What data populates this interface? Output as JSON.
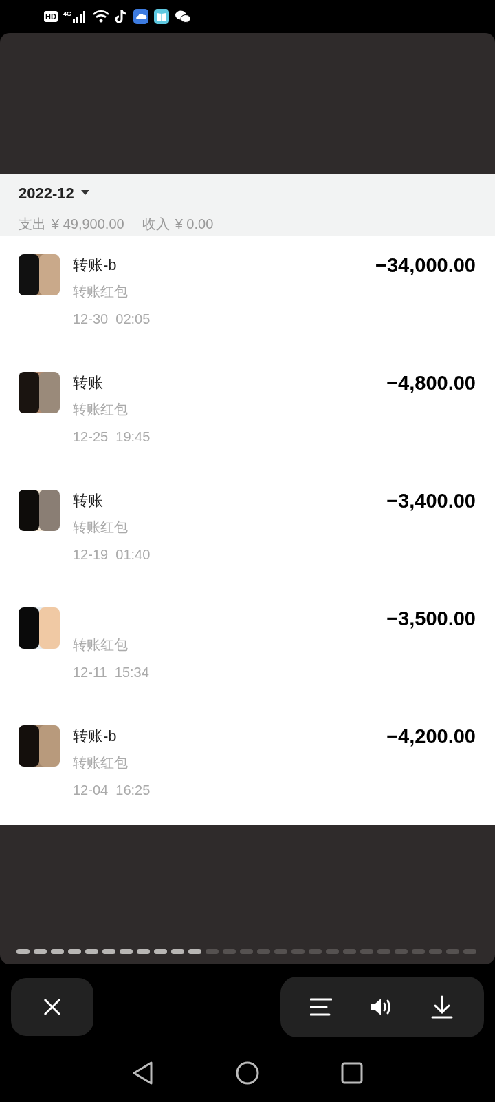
{
  "status_bar": {
    "hd": "HD",
    "network": "4G"
  },
  "month": {
    "label": "2022-12"
  },
  "summary": {
    "expense_label": "支出",
    "expense": "¥ 49,900.00",
    "income_label": "收入",
    "income": "¥ 0.00"
  },
  "transactions": [
    {
      "title": "转账-b",
      "subtitle": "转账红包",
      "time": "12-30  02:05",
      "amount": "−34,000.00"
    },
    {
      "title": "转账",
      "subtitle": "转账红包",
      "time": "12-25  19:45",
      "amount": "−4,800.00"
    },
    {
      "title": "转账",
      "subtitle": "转账红包",
      "time": "12-19  01:40",
      "amount": "−3,400.00"
    },
    {
      "subtitle": "转账红包",
      "time": "12-11  15:34",
      "amount": "−3,500.00"
    },
    {
      "title": "转账-b",
      "subtitle": "转账红包",
      "time": "12-04  16:25",
      "amount": "−4,200.00"
    }
  ],
  "story_progress": [
    {
      "viewed": true
    },
    {
      "viewed": true
    },
    {
      "viewed": true
    },
    {
      "viewed": true
    },
    {
      "viewed": true
    },
    {
      "viewed": true
    },
    {
      "viewed": true
    },
    {
      "viewed": true
    },
    {
      "viewed": true
    },
    {
      "viewed": true
    },
    {
      "viewed": true
    },
    {
      "viewed": false
    },
    {
      "viewed": false
    },
    {
      "viewed": false
    },
    {
      "viewed": false
    },
    {
      "viewed": false
    },
    {
      "viewed": false
    },
    {
      "viewed": false
    },
    {
      "viewed": false
    },
    {
      "viewed": false
    },
    {
      "viewed": false
    },
    {
      "viewed": false
    },
    {
      "viewed": false
    },
    {
      "viewed": false
    },
    {
      "viewed": false
    },
    {
      "viewed": false
    },
    {
      "viewed": false
    }
  ]
}
